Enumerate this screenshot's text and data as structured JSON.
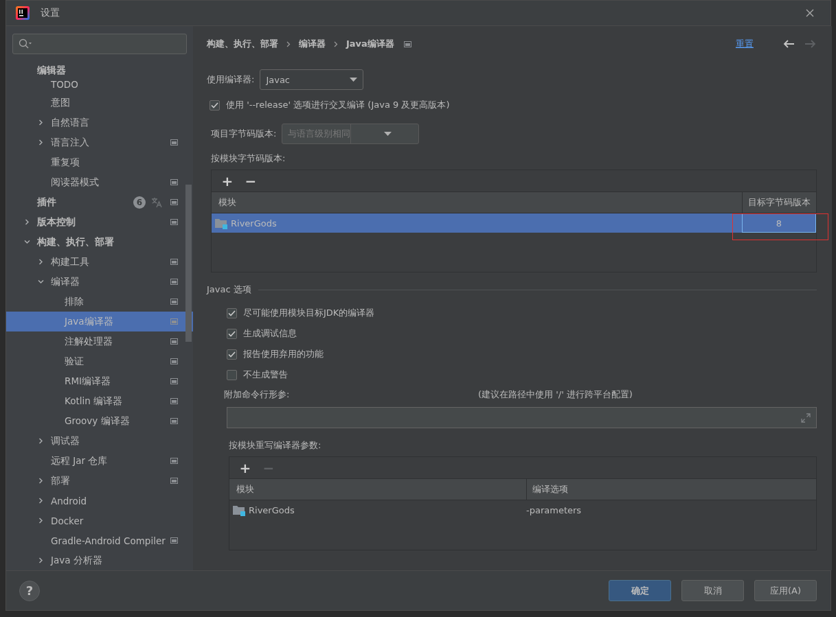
{
  "window": {
    "title": "设置"
  },
  "sidebar": {
    "items": [
      {
        "label": "编辑器",
        "children": [
          {
            "label": "TODO",
            "selected": false,
            "project_scope": false
          },
          {
            "label": "意图",
            "selected": false,
            "project_scope": false
          },
          {
            "label": "自然语言",
            "expanded": false,
            "selected": false,
            "project_scope": false
          },
          {
            "label": "语言注入",
            "expanded": false,
            "selected": false,
            "project_scope": true
          },
          {
            "label": "重复项",
            "selected": false,
            "project_scope": false
          },
          {
            "label": "阅读器模式",
            "selected": false,
            "project_scope": true
          }
        ]
      },
      {
        "label": "插件",
        "badge": "6",
        "translate": true,
        "selected": false,
        "project_scope": true
      },
      {
        "label": "版本控制",
        "expanded": false,
        "selected": false,
        "project_scope": true
      },
      {
        "label": "构建、执行、部署",
        "expanded": true,
        "selected": false,
        "project_scope": false,
        "children": [
          {
            "label": "构建工具",
            "expanded": false,
            "selected": false,
            "project_scope": true
          },
          {
            "label": "编译器",
            "expanded": true,
            "selected": false,
            "project_scope": true,
            "children": [
              {
                "label": "排除",
                "selected": false,
                "project_scope": true
              },
              {
                "label": "Java编译器",
                "selected": true,
                "project_scope": true
              },
              {
                "label": "注解处理器",
                "selected": false,
                "project_scope": true
              },
              {
                "label": "验证",
                "selected": false,
                "project_scope": true
              },
              {
                "label": "RMI编译器",
                "selected": false,
                "project_scope": true
              },
              {
                "label": "Kotlin 编译器",
                "selected": false,
                "project_scope": true
              },
              {
                "label": "Groovy 编译器",
                "selected": false,
                "project_scope": true
              }
            ]
          },
          {
            "label": "调试器",
            "expanded": false,
            "selected": false,
            "project_scope": false
          },
          {
            "label": "远程 Jar 仓库",
            "selected": false,
            "project_scope": true
          },
          {
            "label": "部署",
            "expanded": false,
            "selected": false,
            "project_scope": true
          },
          {
            "label": "Android",
            "expanded": false,
            "selected": false,
            "project_scope": false
          },
          {
            "label": "Docker",
            "expanded": false,
            "selected": false,
            "project_scope": false
          },
          {
            "label": "Gradle-Android Compiler",
            "selected": false,
            "project_scope": true
          },
          {
            "label": "Java 分析器",
            "expanded": false,
            "selected": false,
            "project_scope": false
          }
        ]
      }
    ]
  },
  "breadcrumb": [
    "构建、执行、部署",
    "编译器",
    "Java编译器"
  ],
  "reset_link": "重置",
  "nav": {
    "back_disabled": false,
    "forward_disabled": true
  },
  "compiler": {
    "label": "使用编译器:",
    "value": "Javac"
  },
  "release_option": {
    "label": "使用 '--release' 选项进行交叉编译 (Java 9 及更高版本)",
    "checked": true
  },
  "project_bytecode": {
    "label": "项目字节码版本:",
    "placeholder": "与语言级别相同",
    "disabled": true
  },
  "module_bytecode": {
    "label": "按模块字节码版本:",
    "toolbar": [
      {
        "symbol": "+",
        "disabled": false
      },
      {
        "symbol": "−",
        "disabled": false
      }
    ],
    "columns": [
      "模块",
      "目标字节码版本"
    ],
    "rows": [
      {
        "module": "RiverGods",
        "version": "8",
        "selected": true
      }
    ]
  },
  "javac": {
    "title": "Javac 选项",
    "options": [
      {
        "label": "尽可能使用模块目标JDK的编译器",
        "checked": true
      },
      {
        "label": "生成调试信息",
        "checked": true
      },
      {
        "label": "报告使用弃用的功能",
        "checked": true
      },
      {
        "label": "不生成警告",
        "checked": false
      }
    ],
    "params": {
      "label": "附加命令行形参:",
      "hint": "(建议在路径中使用 '/' 进行跨平台配置)"
    },
    "override": {
      "label": "按模块重写编译器参数:",
      "toolbar": [
        {
          "symbol": "+",
          "disabled": false
        },
        {
          "symbol": "−",
          "disabled": true
        }
      ],
      "columns": [
        "模块",
        "编译选项"
      ],
      "rows": [
        {
          "module": "RiverGods",
          "options": "-parameters"
        }
      ]
    }
  },
  "help": "?",
  "buttons": [
    {
      "label": "确定",
      "kind": "primary"
    },
    {
      "label": "取消",
      "kind": "normal"
    },
    {
      "label": "应用(A)",
      "kind": "normal"
    }
  ]
}
